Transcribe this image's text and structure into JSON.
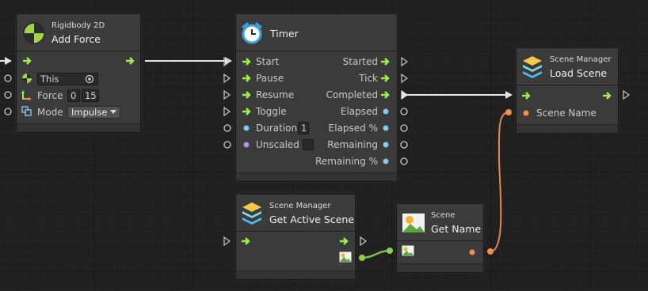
{
  "nodes": {
    "add_force": {
      "category": "Rigidbody 2D",
      "title": "Add Force",
      "target_value": "This",
      "force_label": "Force",
      "force_x": "0",
      "force_y": "15",
      "mode_label": "Mode",
      "mode_value": "Impulse"
    },
    "timer": {
      "title": "Timer",
      "inputs": [
        "Start",
        "Pause",
        "Resume",
        "Toggle",
        "Duration",
        "Unscaled"
      ],
      "outputs": [
        "Started",
        "Tick",
        "Completed",
        "Elapsed",
        "Elapsed %",
        "Remaining",
        "Remaining %"
      ],
      "duration_value": "1"
    },
    "load_scene": {
      "category": "Scene Manager",
      "title": "Load Scene",
      "input_label": "Scene Name"
    },
    "get_active_scene": {
      "category": "Scene Manager",
      "title": "Get Active Scene"
    },
    "get_name": {
      "category": "Scene",
      "title": "Get Name"
    }
  },
  "colors": {
    "background": "#202020",
    "node": "#3b3b3b",
    "control_arrow": "#9cf04a",
    "port_float": "#84c8f0",
    "port_bool": "#b58ee0",
    "port_string": "#f0904a",
    "port_scene": "#8ed14f",
    "wire_control": "#e6e6e6"
  }
}
